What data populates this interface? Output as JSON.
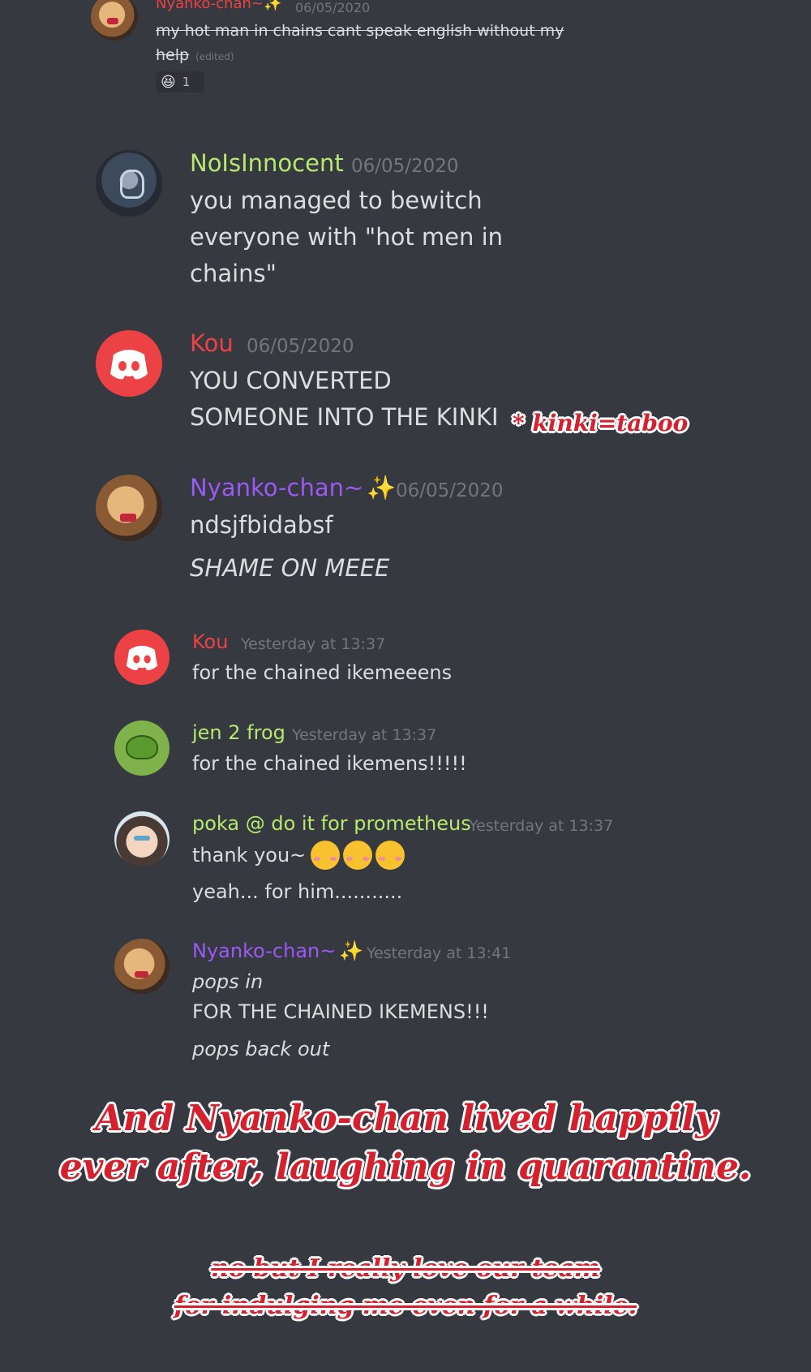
{
  "theme": {
    "background": "#36393f",
    "text_color": "#dcddde",
    "timestamp_color": "#72767d",
    "color_red": "#ed4245",
    "color_green": "#b5e96f",
    "color_purple": "#9b59f5",
    "sticker_red": "#d5202e"
  },
  "messages": [
    {
      "author": "Nyanko-chan~",
      "author_emoji": "✨",
      "timestamp": "06/05/2020",
      "lines": [
        "my hot man in chains cant speak english without my",
        "help"
      ],
      "edited_label": "(edited)",
      "reaction": {
        "emoji": "😆",
        "count": "1"
      },
      "avatar_icon": "cat-figurine-avatar"
    },
    {
      "author": "NoIsInnocent",
      "timestamp": "06/05/2020",
      "lines": [
        "you managed to bewitch",
        "everyone with \"hot men in",
        "chains\""
      ],
      "avatar_icon": "astronaut-avatar"
    },
    {
      "author": "Kou",
      "timestamp": "06/05/2020",
      "lines": [
        "YOU CONVERTED",
        "SOMEONE INTO THE KINKI"
      ],
      "avatar_icon": "discord-logo-avatar"
    },
    {
      "author": "Nyanko-chan~",
      "author_emoji": "✨",
      "timestamp": "06/05/2020",
      "lines": [
        "ndsjfbidabsf",
        "SHAME ON MEEE"
      ],
      "avatar_icon": "cat-figurine-avatar"
    },
    {
      "author": "Kou",
      "timestamp": "Yesterday at 13:37",
      "lines": [
        "for the chained ikemeeens"
      ],
      "avatar_icon": "discord-logo-avatar"
    },
    {
      "author": "jen 2 frog",
      "timestamp": "Yesterday at 13:37",
      "lines": [
        "for the chained ikemens!!!!!"
      ],
      "avatar_icon": "frog-avatar"
    },
    {
      "author": "poka @ do it for prometheus",
      "timestamp": "Yesterday at 13:37",
      "lines": [
        "thank you~",
        "yeah... for him..........."
      ],
      "avatar_icon": "anime-girl-avatar",
      "emoji_name": "smiling-blushing-face-emoji"
    },
    {
      "author": "Nyanko-chan~",
      "author_emoji": "✨",
      "timestamp": "Yesterday at 13:41",
      "lines": [
        "pops in",
        "FOR THE CHAINED IKEMENS!!!",
        "pops back out"
      ],
      "avatar_icon": "cat-figurine-avatar"
    }
  ],
  "annotations": {
    "kinki_note": "* kinki=taboo",
    "caption_line1": "And Nyanko-chan lived happily",
    "caption_line2": "ever after, laughing in quarantine.",
    "footnote_line1": "no but I really love our team",
    "footnote_line2": "for indulging me even for a while."
  }
}
